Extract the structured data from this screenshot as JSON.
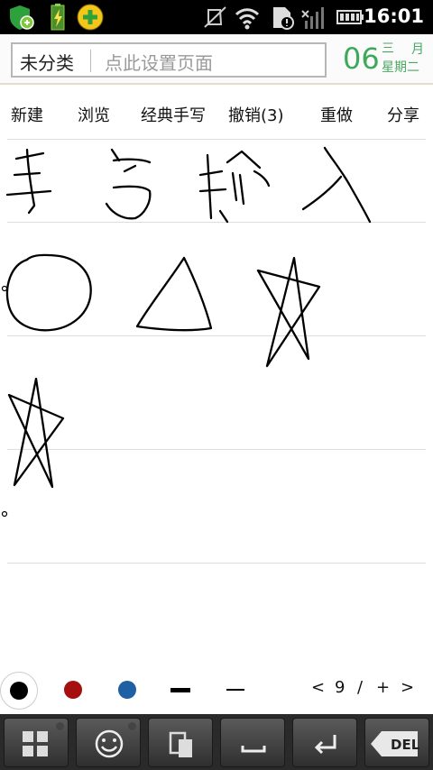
{
  "status_bar": {
    "time": "16:01",
    "notification_icons": [
      "shield-check-icon",
      "battery-charging-icon",
      "add-app-icon"
    ],
    "system_icons": [
      "vibrate-off-icon",
      "wifi-icon",
      "notification-card-icon",
      "signal-off-icon",
      "battery-icon"
    ]
  },
  "title_bar": {
    "category": "未分类",
    "page_placeholder": "点此设置页面",
    "date_day": "06",
    "date_top": "三",
    "date_month": "月",
    "date_weekday": "星期二"
  },
  "toolbar": {
    "new_label": "新建",
    "browse_label": "浏览",
    "handwriting_label": "经典手写",
    "undo_label": "撤销(3)",
    "redo_label": "重做",
    "share_label": "分享"
  },
  "palette": {
    "colors": [
      "#000000",
      "#a50f0f",
      "#1f5fa3"
    ],
    "selected_color": "#000000",
    "pen_sizes": [
      "thick",
      "thin"
    ]
  },
  "pager": {
    "prev": "<",
    "page": "9",
    "separator": "/",
    "add": "+",
    "next": ">"
  },
  "keyboard": {
    "keys": [
      "grid-icon",
      "emoji-icon",
      "clipboard-icon",
      "space-icon",
      "enter-icon",
      "delete-icon"
    ],
    "del_label": "DEL"
  }
}
